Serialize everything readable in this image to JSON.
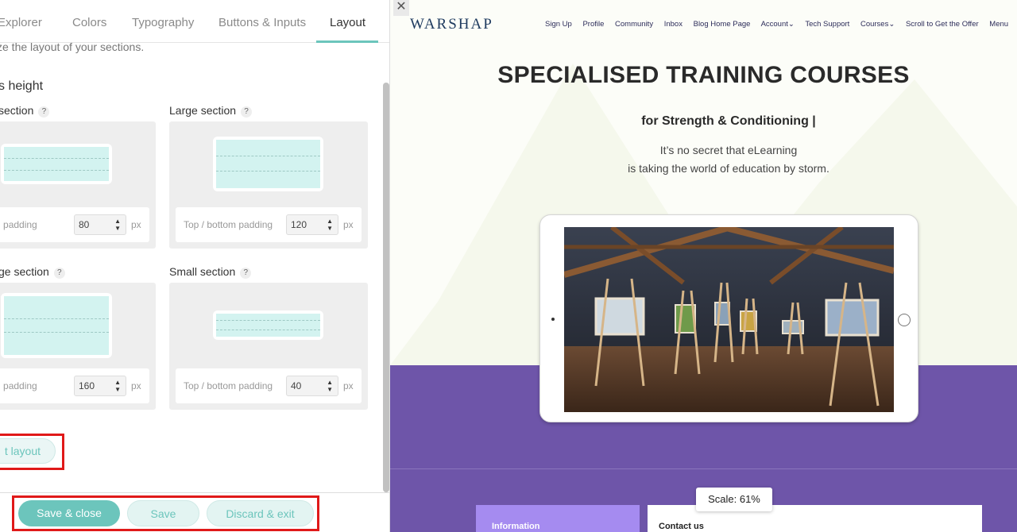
{
  "tabs": [
    {
      "label": "Explorer"
    },
    {
      "label": "Colors"
    },
    {
      "label": "Typography"
    },
    {
      "label": "Buttons & Inputs"
    },
    {
      "label": "Layout"
    }
  ],
  "layout_panel": {
    "intro": "ze the layout of your sections.",
    "heading": "s height",
    "sections": [
      {
        "label": "section",
        "padding_label": "bottom padding",
        "value": "80",
        "unit": "px"
      },
      {
        "label": "Large section",
        "padding_label": "Top / bottom padding",
        "value": "120",
        "unit": "px"
      },
      {
        "label": "ge section",
        "padding_label": "bottom padding",
        "value": "160",
        "unit": "px"
      },
      {
        "label": "Small section",
        "padding_label": "Top / bottom padding",
        "value": "40",
        "unit": "px"
      }
    ],
    "help_glyph": "?",
    "reset_label": "t layout"
  },
  "bottom_bar": {
    "save_close": "Save & close",
    "save": "Save",
    "discard": "Discard & exit"
  },
  "preview": {
    "close_glyph": "✕",
    "logo": "WARSHAP",
    "nav": [
      "Sign Up",
      "Profile",
      "Community",
      "Inbox",
      "Blog Home Page",
      "Account⌄",
      "Tech Support",
      "Courses⌄",
      "Scroll to Get the Offer",
      "Menu"
    ],
    "hero_title": "SPECIALISED TRAINING COURSES",
    "hero_subtitle": "for Strength & Conditioning |",
    "hero_line1": "It’s no secret that eLearning",
    "hero_line2": "is taking the world of education by storm.",
    "info_label": "Information",
    "contact_label": "Contact us",
    "scale_label": "Scale: 61%"
  },
  "colors": {
    "accent": "#6cc5bc",
    "purple": "#6e55a9",
    "highlight": "#e01919"
  }
}
